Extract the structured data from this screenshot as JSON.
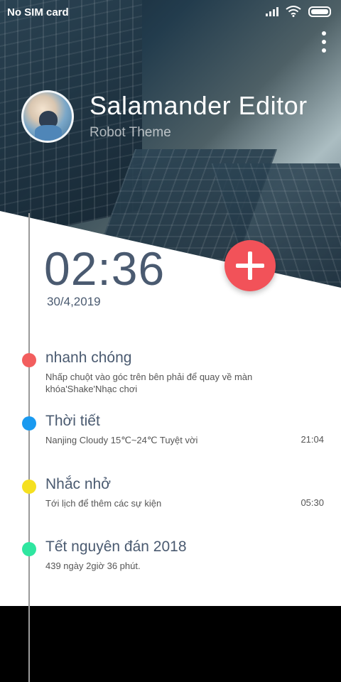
{
  "status_bar": {
    "carrier": "No SIM card"
  },
  "header": {
    "title": "Salamander Editor",
    "subtitle": "Robot Theme"
  },
  "clock": {
    "time": "02:36",
    "date": "30/4,2019"
  },
  "colors": {
    "accent": "#f25259",
    "text": "#4a5a70"
  },
  "timeline": [
    {
      "title": "nhanh chóng",
      "desc": "Nhấp chuột vào góc trên bên phải để quay về màn khóa'Shake'Nhạc chơi",
      "time": "",
      "color": "#f25e5e"
    },
    {
      "title": "Thời tiết",
      "desc": "Nanjing Cloudy 15℃~24℃ Tuyệt vời",
      "time": "21:04",
      "color": "#1a9af0"
    },
    {
      "title": "Nhắc nhở",
      "desc": "Tới lịch để thêm các sự kiện",
      "time": "05:30",
      "color": "#f5e020"
    },
    {
      "title": "Tết nguyên đán 2018",
      "desc": "439 ngày 2giờ 36 phút.",
      "time": "",
      "color": "#2fe6a0"
    }
  ]
}
